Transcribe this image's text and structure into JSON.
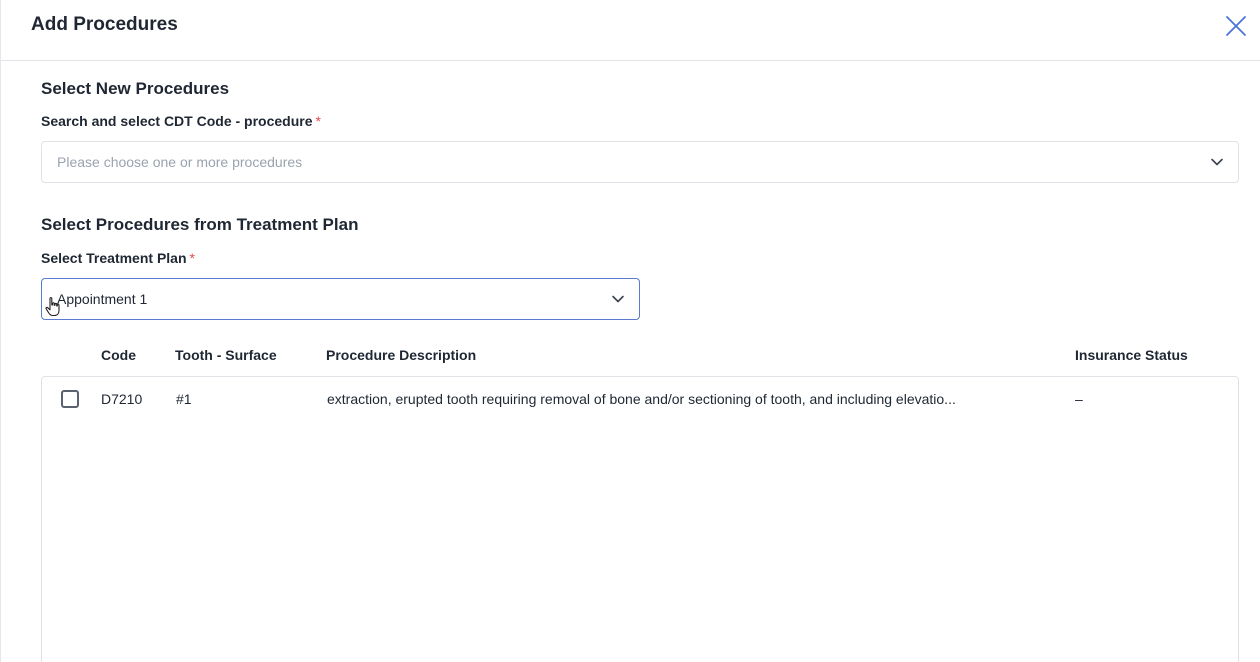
{
  "modal": {
    "title": "Add Procedures"
  },
  "new_procedures": {
    "section_title": "Select New Procedures",
    "field_label": "Search and select CDT Code - procedure",
    "required_marker": "*",
    "placeholder": "Please choose one or more procedures"
  },
  "treatment_plan": {
    "section_title": "Select Procedures from Treatment Plan",
    "field_label": "Select Treatment Plan",
    "required_marker": "*",
    "selected_value": "Appointment 1"
  },
  "table": {
    "columns": [
      "Code",
      "Tooth - Surface",
      "Procedure Description",
      "Insurance Status"
    ],
    "rows": [
      {
        "checked": false,
        "code": "D7210",
        "tooth_surface": "#1",
        "description": "extraction, erupted tooth requiring removal of bone and/or sectioning of tooth, and including elevatio...",
        "insurance_status": "–"
      }
    ]
  },
  "colors": {
    "accent": "#5b7ad1",
    "required": "#e5484d",
    "text": "#1f2733",
    "placeholder": "#9aa3ae"
  }
}
